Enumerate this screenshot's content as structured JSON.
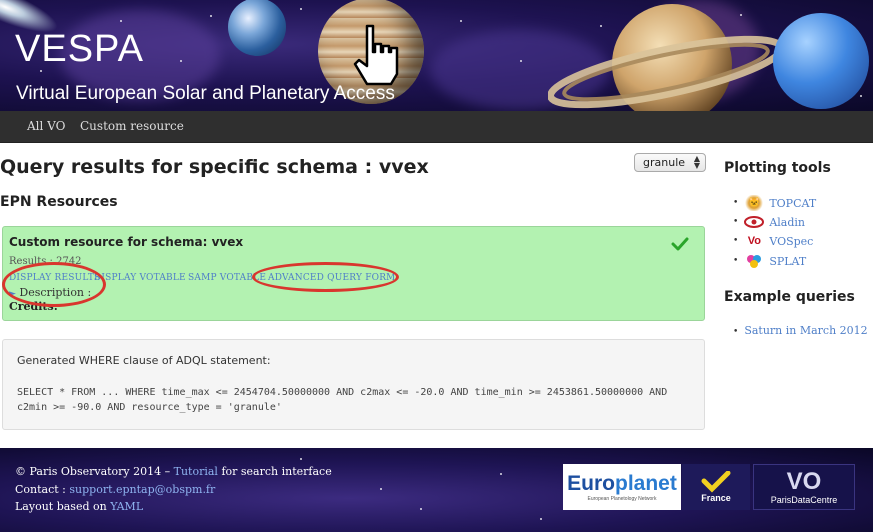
{
  "banner": {
    "title": "VESPA",
    "subtitle": "Virtual European Solar and Planetary Access"
  },
  "nav": {
    "items": [
      "All VO",
      "Custom resource"
    ]
  },
  "main": {
    "page_title": "Query results for specific schema : vvex",
    "schema_select_value": "granule",
    "section_title": "EPN Resources",
    "resource": {
      "title": "Custom resource for schema: vvex",
      "results": "Results : 2742",
      "links": [
        "DISPLAY RESULTS",
        "DISPLAY VOTABLE",
        "SAMP VOTABLE",
        "ADVANCED QUERY FORM"
      ],
      "description_label": "Description :",
      "credits_label": "Credits:",
      "status_color": "#2aa52a"
    },
    "adql": {
      "label": "Generated WHERE clause of ADQL statement:",
      "line1": "SELECT * FROM ... WHERE time_max <= 2454704.50000000 AND c2max <= -20.0 AND time_min >= 2453861.50000000 AND",
      "line2": "c2min >= -90.0 AND resource_type = 'granule'"
    },
    "highlight_color": "#d9362e"
  },
  "sidebar": {
    "plotting_heading": "Plotting tools",
    "tools": [
      {
        "name": "TOPCAT",
        "icon": "topcat-logo-icon"
      },
      {
        "name": "Aladin",
        "icon": "aladin-logo-icon"
      },
      {
        "name": "VOSpec",
        "icon": "vospec-logo-icon"
      },
      {
        "name": "SPLAT",
        "icon": "splat-logo-icon"
      }
    ],
    "examples_heading": "Example queries",
    "examples": [
      "Saturn in March 2012"
    ]
  },
  "footer": {
    "copyright_prefix": "© Paris Observatory 2014 – ",
    "tutorial_link": "Tutorial",
    "copyright_suffix": " for search interface",
    "contact_prefix": "Contact : ",
    "contact_email": "support.epntap@obspm.fr",
    "layout_prefix": "Layout based on ",
    "layout_link": "YAML",
    "partners": {
      "europlanet_left": "Euro",
      "europlanet_right": "planet",
      "europlanet_small": "European Planetology Network",
      "france": "France",
      "vo": "VO",
      "pdc": "ParisDataCentre"
    }
  }
}
